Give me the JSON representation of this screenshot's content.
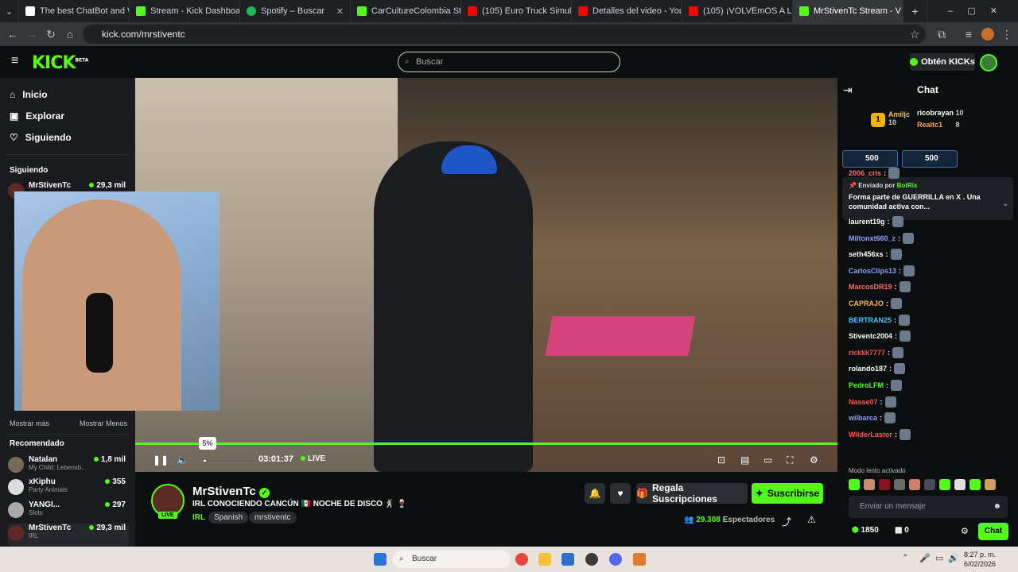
{
  "browser": {
    "tabs": [
      {
        "title": "The best ChatBot and Wi",
        "color": "#ffffff"
      },
      {
        "title": "Stream - Kick Dashboard",
        "color": "#53fc18"
      },
      {
        "title": "Spotify – Buscar",
        "color": "#1db954"
      },
      {
        "title": "CarCultureColombia Stre",
        "color": "#53fc18"
      },
      {
        "title": "(105) Euro Truck Simulato",
        "color": "#ff0000"
      },
      {
        "title": "Detalles del video - YouTu",
        "color": "#ff0000"
      },
      {
        "title": "(105) ¡VOLVEmOS A La RU",
        "color": "#ff0000"
      },
      {
        "title": "MrStivenTc Stream - V",
        "color": "#53fc18"
      }
    ],
    "url": "kick.com/mrstiventc"
  },
  "header": {
    "logo": "KICK",
    "logo_badge": "BETA",
    "search_placeholder": "Buscar",
    "kicks_button": "Obtén KICKs"
  },
  "sidebar": {
    "nav": [
      {
        "label": "Inicio",
        "icon": "home-icon"
      },
      {
        "label": "Explorar",
        "icon": "compass-icon"
      },
      {
        "label": "Siguiendo",
        "icon": "heart-icon"
      }
    ],
    "following_title": "Siguiendo",
    "following": [
      {
        "name": "MrStivenTc",
        "viewers": "29,3 mil"
      }
    ],
    "show_more": "Mostrar más",
    "show_less": "Mostrar Menos",
    "recommended_title": "Recomendado",
    "recommended": [
      {
        "name": "Natalan",
        "sub": "My Child: Lebensb...",
        "viewers": "1,8 mil"
      },
      {
        "name": "xKiphu",
        "sub": "Party Animals",
        "viewers": "355"
      },
      {
        "name": "YANGI...",
        "sub": "Slots",
        "viewers": "297"
      },
      {
        "name": "MrStivenTc",
        "sub": "IRL",
        "viewers": "29,3 mil"
      }
    ]
  },
  "player": {
    "volume_tooltip": "5%",
    "elapsed": "03:01:37",
    "live_label": "LIVE",
    "progress": 1.0
  },
  "stream": {
    "streamer": "MrStivenTc",
    "live_badge": "LIVE",
    "title": "IRL CONOCIENDO CANCÚN 🇲🇽 NOCHE DE DISCO 🕺 🍷",
    "category": "IRL",
    "tags": [
      "Spanish",
      "mrstiventc"
    ],
    "gift_button": "Regala Suscripciones",
    "subscribe_button": "Suscribirse",
    "viewers": "29.308",
    "viewers_label": "Espectadores"
  },
  "chat": {
    "title": "Chat",
    "leaders": [
      {
        "name": "Amiljc",
        "value": "10"
      },
      {
        "name": "ricobrayan",
        "value": "10"
      },
      {
        "name": "Realtc1",
        "value": "8"
      }
    ],
    "goals": [
      "500",
      "500"
    ],
    "pinned_sender_label": "Enviado por",
    "pinned_sender": "BotRix",
    "pinned_message": "Forma parte de GUERRILLA en X . Una comunidad activa con...",
    "messages": [
      {
        "user": "CarlosClips13",
        "color": "#8aa0ff"
      },
      {
        "user": "2006_cris",
        "color": "#ff6b6b"
      },
      {
        "user": "laurent19g",
        "color": "#ffffff"
      },
      {
        "user": "Miltonxt660_z",
        "color": "#8aa0ff"
      },
      {
        "user": "seth456xs",
        "color": "#ffffff"
      },
      {
        "user": "CarlosClips13",
        "color": "#8aa0ff"
      },
      {
        "user": "MarcosDR19",
        "color": "#ff6b6b"
      },
      {
        "user": "CAPRAJO",
        "color": "#ffb347"
      },
      {
        "user": "BERTRAN25",
        "color": "#4fc3f7"
      },
      {
        "user": "Stiventc2004",
        "color": "#ffffff"
      },
      {
        "user": "rickkk7777",
        "color": "#ff5252"
      },
      {
        "user": "rolando187",
        "color": "#ffffff"
      },
      {
        "user": "PedroLFM",
        "color": "#53fc18"
      },
      {
        "user": "Nasse07",
        "color": "#ff5252"
      },
      {
        "user": "wilbarca",
        "color": "#8aa0ff"
      },
      {
        "user": "WilderLastor",
        "color": "#ff5252"
      }
    ],
    "slow_mode": "Modo lento activado",
    "input_placeholder": "Enviar un mensaje",
    "points": "1850",
    "bonus": "0",
    "send_button": "Chat"
  },
  "taskbar": {
    "search_placeholder": "Buscar",
    "time": "8:27 p. m.",
    "date": "6/02/2026"
  }
}
